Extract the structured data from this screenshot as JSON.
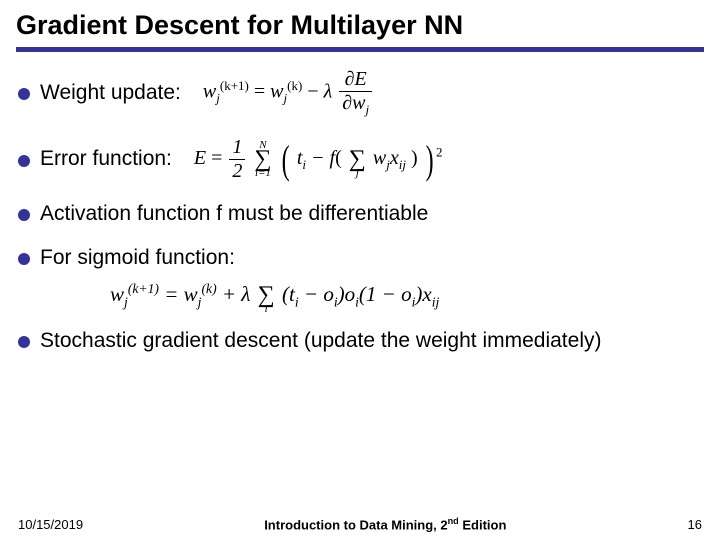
{
  "title": "Gradient Descent for Multilayer NN",
  "bullets": {
    "weight_update": "Weight update:",
    "error_function": "Error function:",
    "activation": "Activation function f must be differentiable",
    "sigmoid": "For sigmoid function:",
    "sgd": "Stochastic gradient descent (update the weight immediately)"
  },
  "equations": {
    "weight_update": {
      "lhs": "w",
      "lhs_sub": "j",
      "lhs_sup": "(k+1)",
      "eq": " = ",
      "r1": "w",
      "r1_sub": "j",
      "r1_sup": "(k)",
      "minus": " − ",
      "lambda": "λ",
      "frac_num_a": "∂E",
      "frac_den_a": "∂w",
      "frac_den_sub": "j"
    },
    "error": {
      "E": "E",
      "eq": " = ",
      "half_num": "1",
      "half_den": "2",
      "sum_top": "N",
      "sum_bot": "i=1",
      "t": "t",
      "t_sub": "i",
      "minus": " − f",
      "lpar": "(",
      "sum_j": "j",
      "w": "w",
      "w_sub": "j",
      "x": "x",
      "x_sub": "ij",
      "rpar": ")",
      "sq": "2"
    },
    "sigmoid": {
      "lhs": "w",
      "lhs_sub": "j",
      "lhs_sup": "(k+1)",
      "eq": " = ",
      "r1": "w",
      "r1_sub": "j",
      "r1_sup": "(k)",
      "plus": " + ",
      "lambda": "λ",
      "sum_bot": "i",
      "t": "t",
      "t_sub": "i",
      "minus": " − ",
      "o": "o",
      "o_sub": "i",
      "one_minus": "1 − ",
      "x": "x",
      "x_sub": "ij"
    }
  },
  "footer": {
    "date": "10/15/2019",
    "book_a": "Introduction to Data Mining, 2",
    "book_sup": "nd",
    "book_b": " Edition",
    "page": "16"
  }
}
